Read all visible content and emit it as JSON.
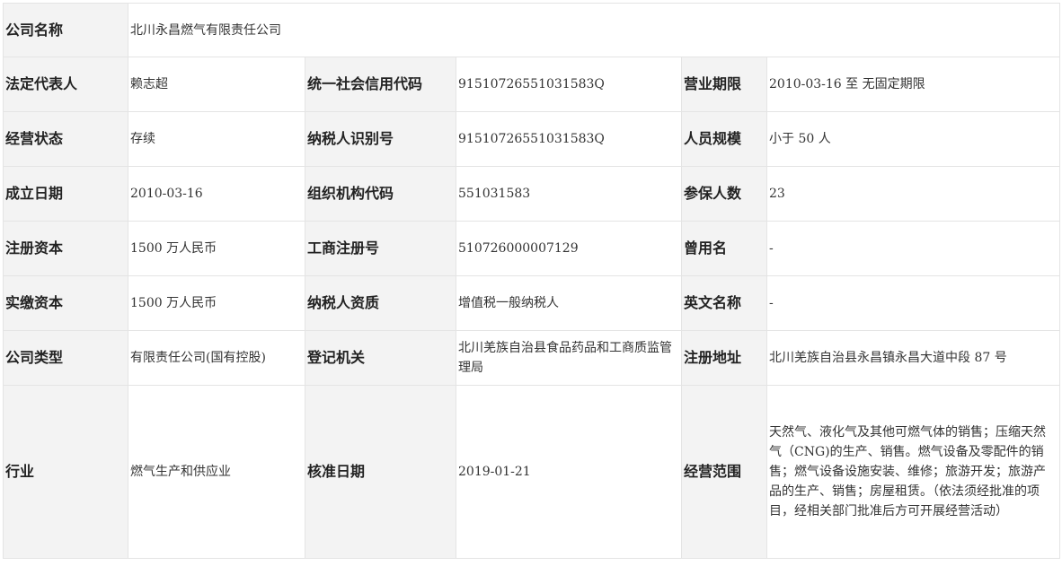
{
  "company": {
    "name_label": "公司名称",
    "name": "北川永昌燃气有限责任公司"
  },
  "rows": [
    {
      "l1": "法定代表人",
      "v1": "赖志超",
      "l2": "统一社会信用代码",
      "v2": "91510726551031583Q",
      "l3": "营业期限",
      "v3": "2010-03-16 至 无固定期限"
    },
    {
      "l1": "经营状态",
      "v1": "存续",
      "l2": "纳税人识别号",
      "v2": "91510726551031583Q",
      "l3": "人员规模",
      "v3": "小于 50 人"
    },
    {
      "l1": "成立日期",
      "v1": "2010-03-16",
      "l2": "组织机构代码",
      "v2": "551031583",
      "l3": "参保人数",
      "v3": "23"
    },
    {
      "l1": "注册资本",
      "v1": "1500 万人民币",
      "l2": "工商注册号",
      "v2": "510726000007129",
      "l3": "曾用名",
      "v3": "-"
    },
    {
      "l1": "实缴资本",
      "v1": "1500 万人民币",
      "l2": "纳税人资质",
      "v2": "增值税一般纳税人",
      "l3": "英文名称",
      "v3": "-"
    },
    {
      "l1": "公司类型",
      "v1": "有限责任公司(国有控股)",
      "l2": "登记机关",
      "v2": "北川羌族自治县食品药品和工商质监管理局",
      "l3": "注册地址",
      "v3": "北川羌族自治县永昌镇永昌大道中段 87 号"
    },
    {
      "l1": "行业",
      "v1": "燃气生产和供应业",
      "l2": "核准日期",
      "v2": "2019-01-21",
      "l3": "经营范围",
      "v3": "天然气、液化气及其他可燃气体的销售；压缩天然气（CNG)的生产、销售。燃气设备及零配件的销售；燃气设备设施安装、维修；旅游开发；旅游产品的生产、销售；房屋租赁。（依法须经批准的项目，经相关部门批准后方可开展经营活动）"
    }
  ]
}
